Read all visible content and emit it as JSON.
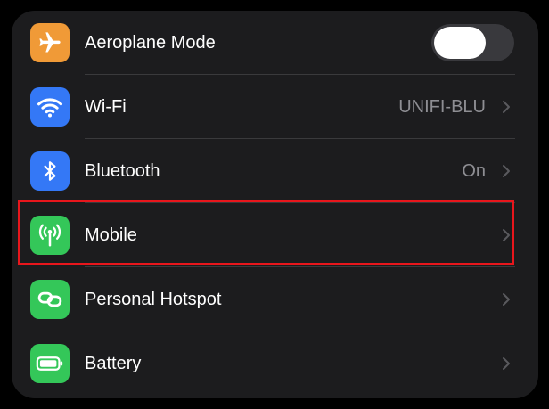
{
  "settings": {
    "rows": [
      {
        "label": "Aeroplane Mode",
        "icon": "airplane-icon",
        "icon_color": "#f09a37",
        "toggle_on": false
      },
      {
        "label": "Wi-Fi",
        "value": "UNIFI-BLU",
        "icon": "wifi-icon",
        "icon_color": "#3478f6"
      },
      {
        "label": "Bluetooth",
        "value": "On",
        "icon": "bluetooth-icon",
        "icon_color": "#3478f6"
      },
      {
        "label": "Mobile",
        "icon": "antenna-icon",
        "icon_color": "#34c759"
      },
      {
        "label": "Personal Hotspot",
        "icon": "link-icon",
        "icon_color": "#34c759"
      },
      {
        "label": "Battery",
        "icon": "battery-icon",
        "icon_color": "#34c759"
      }
    ]
  },
  "highlight": {
    "color": "#e8161c"
  },
  "colors": {
    "background": "#000000",
    "card": "#1c1c1e",
    "divider": "#3a3a3c",
    "secondary_text": "#8e8e93"
  }
}
